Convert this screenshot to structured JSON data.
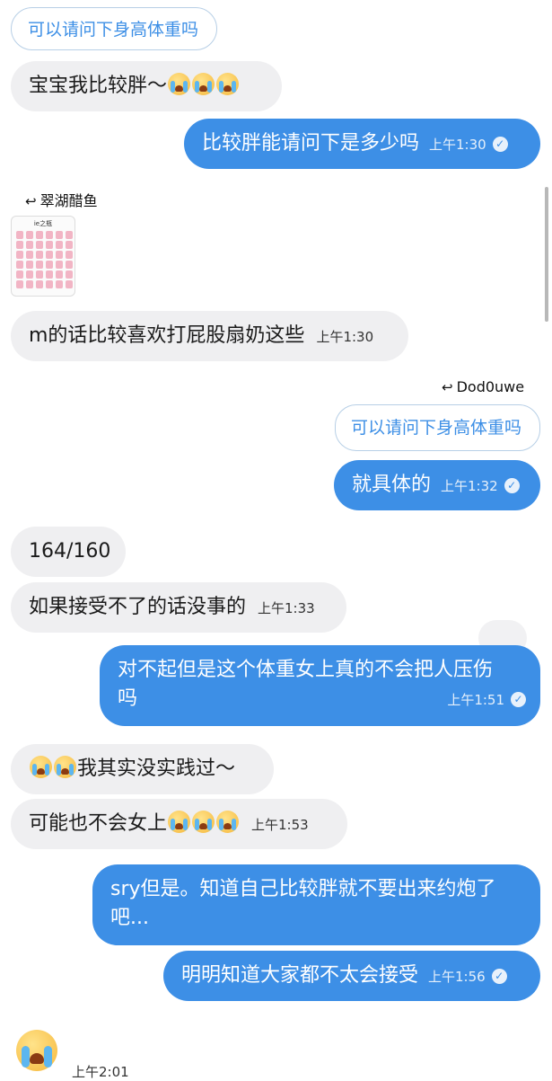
{
  "messages": {
    "m1_quote": "可以请问下身高体重吗",
    "m2": "宝宝我比较胖～",
    "m3": "比较胖能请问下是多少吗",
    "m3_time": "上午1:30",
    "reply1_name": "翠湖醋鱼",
    "sticker_title": "ie之瓶",
    "m4": "m的话比较喜欢打屁股扇奶这些",
    "m4_time": "上午1:30",
    "reply2_name": "Dod0uwe",
    "m5_quote": "可以请问下身高体重吗",
    "m5": "就具体的",
    "m5_time": "上午1:32",
    "m6": "164/160",
    "m7": "如果接受不了的话没事的",
    "m7_time": "上午1:33",
    "m8_line1": "对不起但是这个体重女上真的不会把人压伤",
    "m8_line2": "吗",
    "m8_time": "上午1:51",
    "m9": "我其实没实践过～",
    "m10": "可能也不会女上",
    "m10_time": "上午1:53",
    "m11_line1": "sry但是。知道自己比较胖就不要出来约炮了",
    "m11_line2": "吧...",
    "m12": "明明知道大家都不太会接受",
    "m12_time": "上午1:56",
    "m13_time": "上午2:01"
  },
  "icons": {
    "cry": "loudly-crying-face-emoji",
    "read": "read-check-icon",
    "reply": "reply-arrow-icon"
  },
  "colors": {
    "outgoing": "#3d8fe6",
    "incoming": "#efeff1"
  }
}
